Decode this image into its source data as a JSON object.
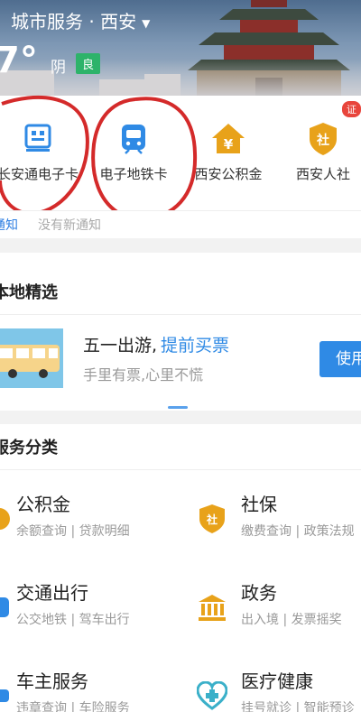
{
  "header": {
    "title": "城市服务 · 西安",
    "caret": "▼",
    "temperature": "7°",
    "weather": "阴",
    "aqi": "良"
  },
  "quick_items": [
    {
      "label": "长安通电子卡",
      "icon": "card-icon"
    },
    {
      "label": "电子地铁卡",
      "icon": "metro-icon"
    },
    {
      "label": "西安公积金",
      "icon": "housing-fund-icon"
    },
    {
      "label": "西安人社",
      "icon": "social-security-icon"
    }
  ],
  "badge": "证",
  "notice": {
    "tag": "通知",
    "text": "没有新通知"
  },
  "local": {
    "title": "本地精选",
    "promo_title": "五一出游,",
    "promo_highlight": "提前买票",
    "promo_sub": "手里有票,心里不慌",
    "use_button": "使用"
  },
  "services": {
    "title": "服务分类",
    "items": [
      {
        "name": "公积金",
        "desc": "余额查询 | 贷款明细",
        "icon": "fund-icon"
      },
      {
        "name": "社保",
        "desc": "缴费查询 | 政策法规",
        "icon": "shield-icon"
      },
      {
        "name": "交通出行",
        "desc": "公交地铁 | 驾车出行",
        "icon": "transport-icon"
      },
      {
        "name": "政务",
        "desc": "出入境 | 发票摇奖",
        "icon": "government-icon"
      },
      {
        "name": "车主服务",
        "desc": "违章查询 | 车险服务",
        "icon": "car-icon"
      },
      {
        "name": "医疗健康",
        "desc": "挂号就诊 | 智能预诊",
        "icon": "medical-icon"
      }
    ]
  },
  "colors": {
    "accent": "#2f8ae5",
    "gold": "#e8a21a",
    "red_mark": "#d42a2a",
    "aqi_green": "#2db36a"
  }
}
